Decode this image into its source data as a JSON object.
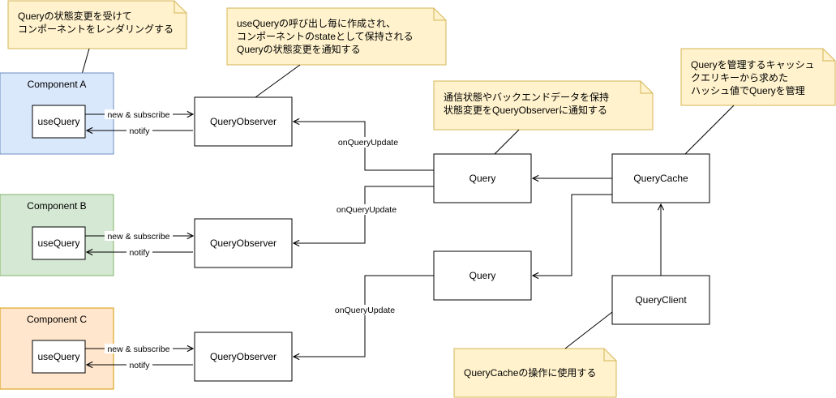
{
  "components": [
    {
      "title": "Component A",
      "hook": "useQuery",
      "observer": "QueryObserver",
      "subscribe_label": "new & subscribe",
      "notify_label": "notify",
      "fill": "#dae8fc",
      "stroke": "#6c8ebf"
    },
    {
      "title": "Component B",
      "hook": "useQuery",
      "observer": "QueryObserver",
      "subscribe_label": "new & subscribe",
      "notify_label": "notify",
      "fill": "#d5e8d4",
      "stroke": "#82b366"
    },
    {
      "title": "Component C",
      "hook": "useQuery",
      "observer": "QueryObserver",
      "subscribe_label": "new & subscribe",
      "notify_label": "notify",
      "fill": "#ffe6cc",
      "stroke": "#d79b00"
    }
  ],
  "queries": [
    "Query",
    "Query"
  ],
  "query_cache": "QueryCache",
  "query_client": "QueryClient",
  "edge_labels": {
    "on_query_update": "onQueryUpdate"
  },
  "notes": {
    "hook_note": [
      "Queryの状態変更を受けて",
      "コンポーネントをレンダリングする"
    ],
    "observer_note": [
      "useQueryの呼び出し毎に作成され、",
      "コンポーネントのstateとして保持される",
      "Queryの状態変更を通知する"
    ],
    "query_note": [
      "通信状態やバックエンドデータを保持",
      "状態変更をQueryObserverに通知する"
    ],
    "cache_note": [
      "Queryを管理するキャッシュ",
      "クエリキーから求めた",
      "ハッシュ値でQueryを管理"
    ],
    "client_note": [
      "QueryCacheの操作に使用する"
    ]
  },
  "colors": {
    "note_fill": "#fff2cc",
    "note_stroke": "#d6b656",
    "line": "#000000"
  }
}
